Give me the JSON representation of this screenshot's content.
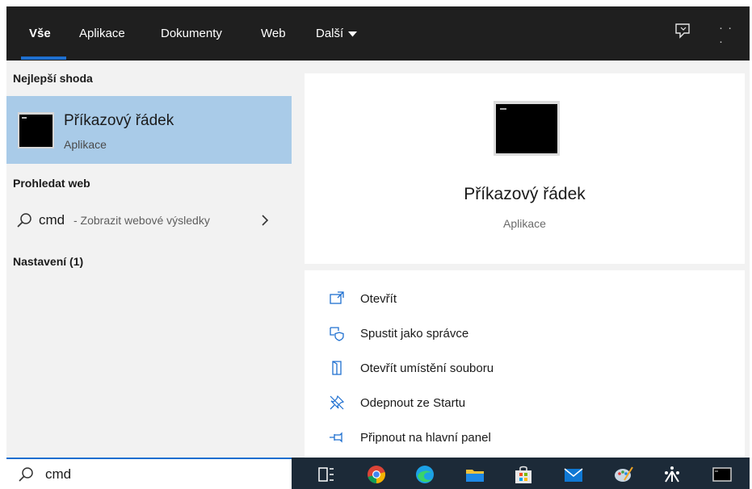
{
  "tabs": [
    {
      "label": "Vše",
      "active": true
    },
    {
      "label": "Aplikace"
    },
    {
      "label": "Dokumenty"
    },
    {
      "label": "Web"
    },
    {
      "label": "Další"
    }
  ],
  "header_icons": [
    "feedback-icon",
    "more-options-icon"
  ],
  "left": {
    "best_match_heading": "Nejlepší shoda",
    "best_match": {
      "title": "Příkazový řádek",
      "subtitle": "Aplikace",
      "icon": "command-prompt-icon"
    },
    "search_web_heading": "Prohledat web",
    "web_result": {
      "query": "cmd",
      "suffix": "- Zobrazit webové výsledky"
    },
    "settings_heading": "Nastavení (1)"
  },
  "preview": {
    "title": "Příkazový řádek",
    "subtitle": "Aplikace",
    "actions": [
      {
        "label": "Otevřít",
        "icon": "open-icon"
      },
      {
        "label": "Spustit jako správce",
        "icon": "run-as-admin-icon"
      },
      {
        "label": "Otevřít umístění souboru",
        "icon": "open-file-location-icon"
      },
      {
        "label": "Odepnout ze Startu",
        "icon": "unpin-icon"
      },
      {
        "label": "Připnout na hlavní panel",
        "icon": "pin-taskbar-icon"
      }
    ]
  },
  "search_box": {
    "value": "cmd"
  },
  "taskbar": {
    "icons": [
      "task-view-icon",
      "chrome-icon",
      "edge-icon",
      "file-explorer-icon",
      "store-icon",
      "mail-icon",
      "paint-icon",
      "app-icon",
      "command-prompt-icon"
    ]
  },
  "colors": {
    "accent": "#1e6fd0",
    "selected": "#a9cbe8",
    "header": "#1f1f1f",
    "taskbar": "#1c2a38"
  }
}
